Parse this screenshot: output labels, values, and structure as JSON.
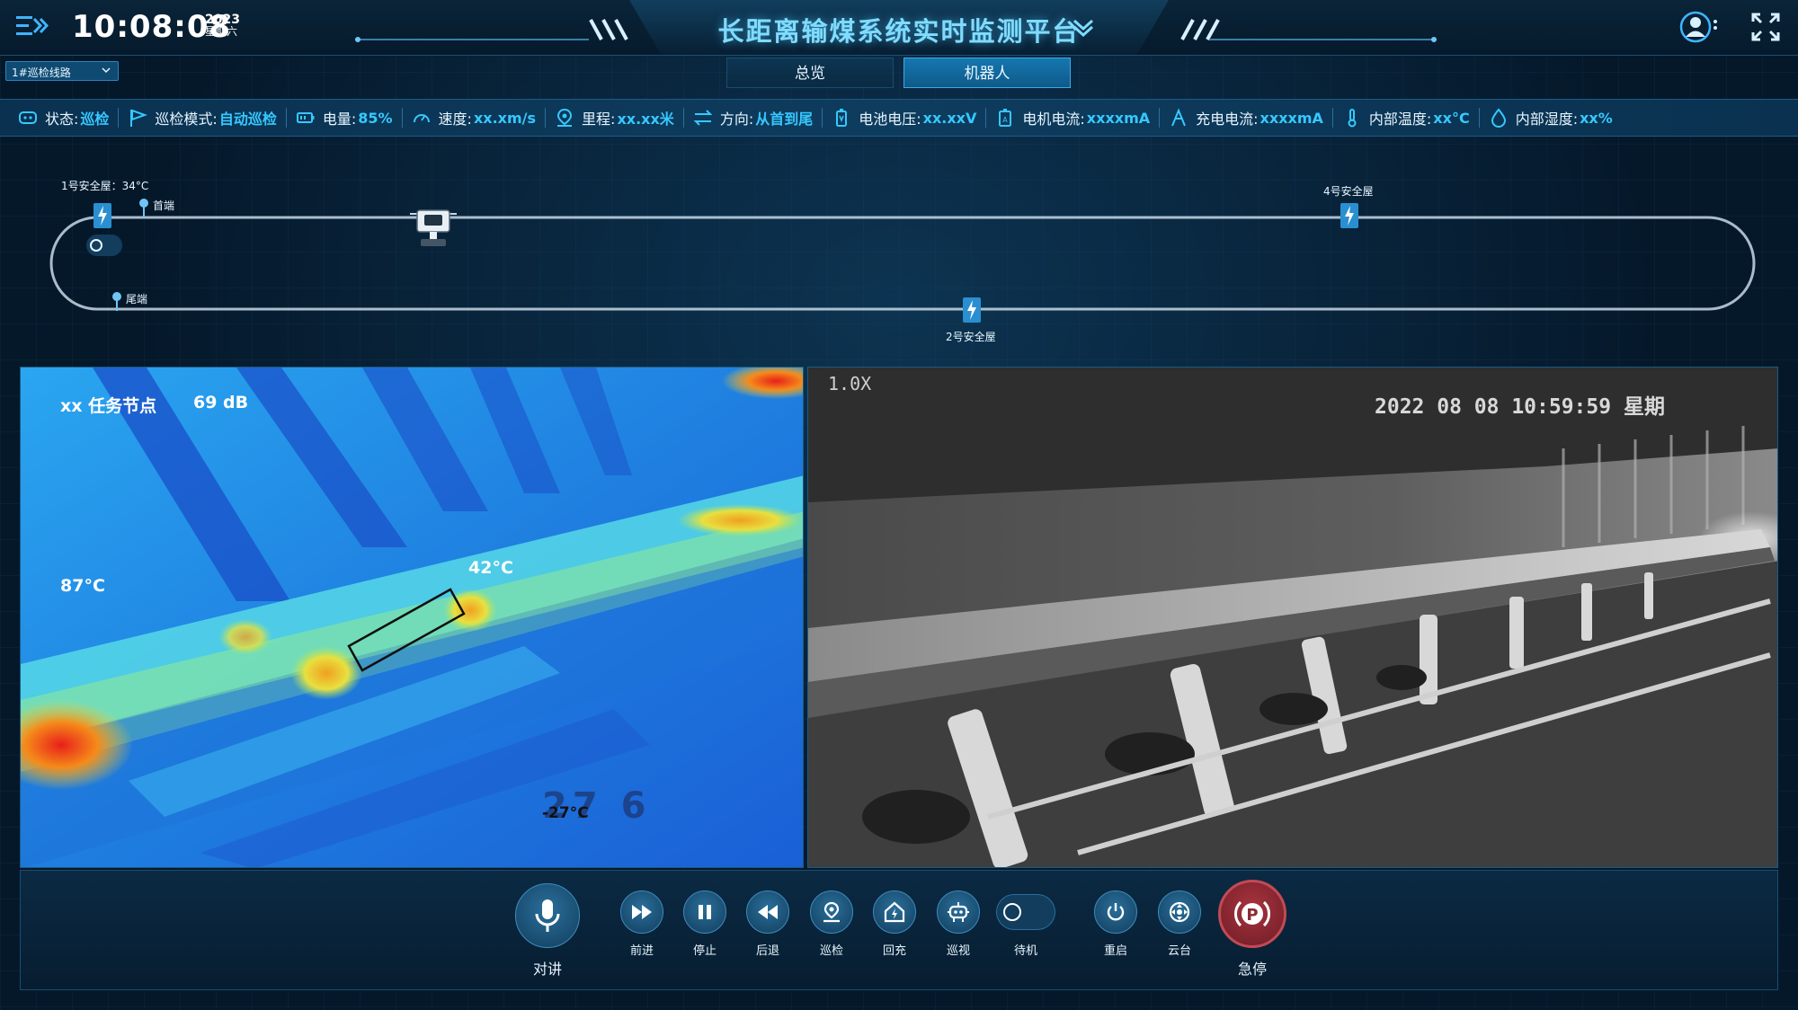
{
  "header": {
    "time": "10:08:08",
    "year": "2023",
    "weekday": "星期六",
    "title": "长距离输煤系统实时监测平台"
  },
  "nav": {
    "route_select": "1#巡检线路",
    "tabs": [
      {
        "label": "总览",
        "active": false
      },
      {
        "label": "机器人",
        "active": true
      }
    ]
  },
  "status": {
    "state": {
      "label": "状态:",
      "value": "巡检"
    },
    "mode": {
      "label": "巡检模式:",
      "value": "自动巡检"
    },
    "battery": {
      "label": "电量:",
      "value": "85%"
    },
    "speed": {
      "label": "速度:",
      "value": "xx.xm/s"
    },
    "mileage": {
      "label": "里程:",
      "value": "xx.xx米"
    },
    "direction": {
      "label": "方向:",
      "value": "从首到尾"
    },
    "battery_voltage": {
      "label": "电池电压:",
      "value": "xx.xxV"
    },
    "motor_current": {
      "label": "电机电流:",
      "value": "xxxxmA"
    },
    "charge_current": {
      "label": "充电电流:",
      "value": "xxxxmA"
    },
    "inner_temp": {
      "label": "内部温度:",
      "value": "xx°C"
    },
    "inner_humidity": {
      "label": "内部湿度:",
      "value": "xx%"
    }
  },
  "track": {
    "shelter1": "1号安全屋：34°C",
    "head": "首端",
    "tail": "尾端",
    "shelter2": "2号安全屋",
    "shelter4": "4号安全屋"
  },
  "thermal": {
    "task_node": "xx 任务节点",
    "db": "69 dB",
    "temp_left": "87°C",
    "temp_box": "42°C",
    "temp_low": "-27°C",
    "bottom_mark": "27 6"
  },
  "camera": {
    "zoom": "1.0X",
    "timestamp": "2022 08 08 10:59:59 星期"
  },
  "controls": {
    "talk": "对讲",
    "forward": "前进",
    "stop": "停止",
    "back": "后退",
    "patrol": "巡检",
    "recharge": "回充",
    "inspect": "巡视",
    "standby": "待机",
    "restart": "重启",
    "ptz": "云台",
    "estop": "急停"
  },
  "colors": {
    "accent": "#36c8ff",
    "title": "#7fdcff",
    "active_tab": "#1577b0",
    "estop": "#8a2a33"
  }
}
